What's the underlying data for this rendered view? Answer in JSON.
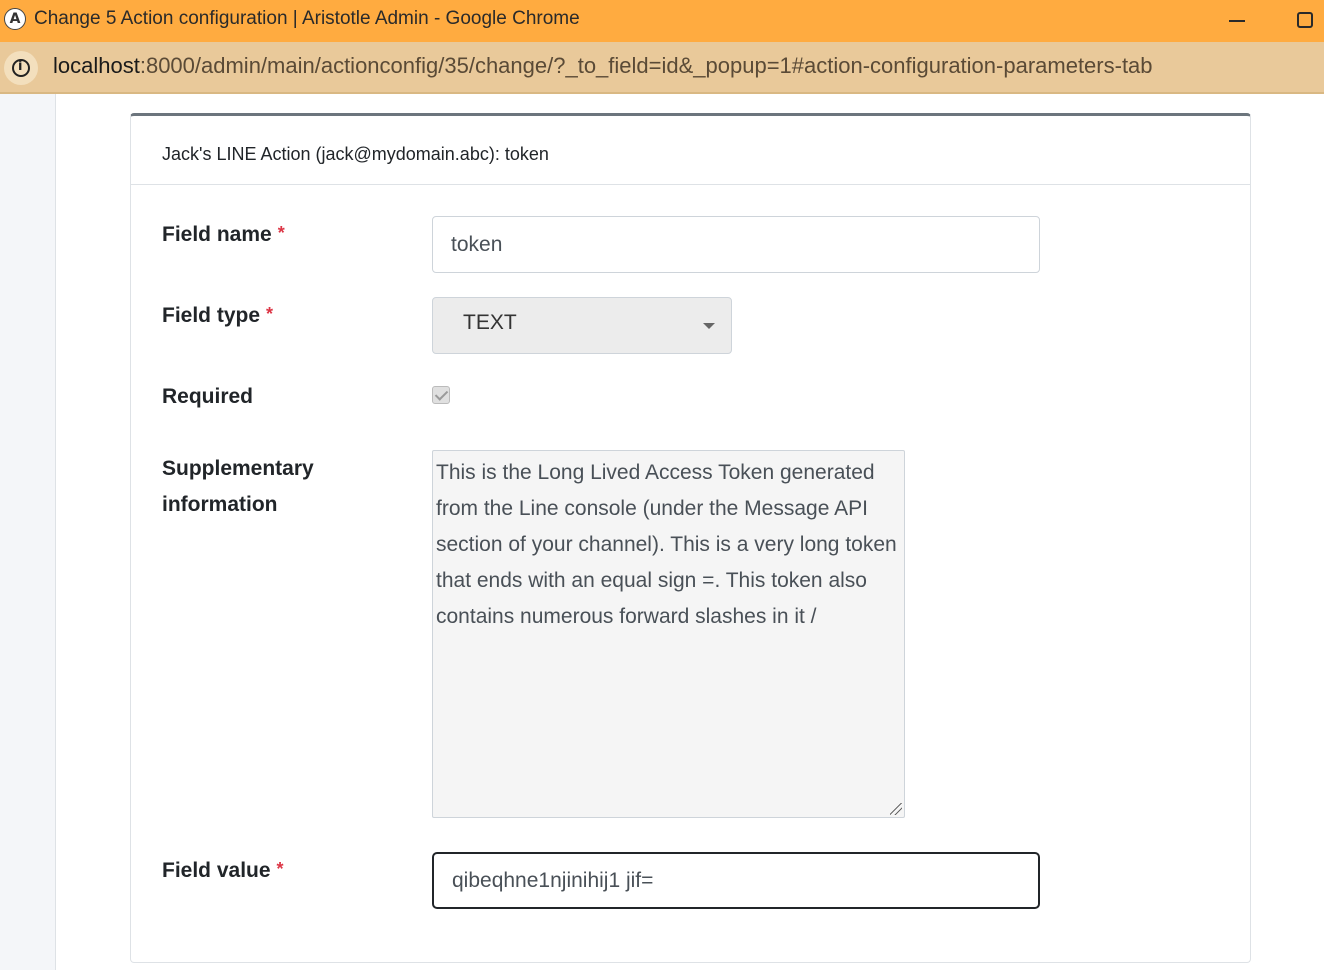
{
  "window": {
    "title": "Change 5 Action configuration | Aristotle Admin - Google Chrome",
    "app_icon_letter": "A"
  },
  "address_bar": {
    "host": "localhost",
    "path": ":8000/admin/main/actionconfig/35/change/?_to_field=id&_popup=1#action-configuration-parameters-tab"
  },
  "card": {
    "title": "Jack's LINE Action (jack@mydomain.abc): token"
  },
  "form": {
    "field_name": {
      "label": "Field name",
      "required_mark": "*",
      "value": "token"
    },
    "field_type": {
      "label": "Field type",
      "required_mark": "*",
      "value": "TEXT"
    },
    "required": {
      "label": "Required",
      "checked": true
    },
    "supplementary": {
      "label_line1": "Supplementary",
      "label_line2": "information",
      "value": "This is the Long Lived Access Token generated from the Line console (under the Message API section of your channel). This is a very long token that ends with an equal sign =. This token also contains numerous forward slashes in it /"
    },
    "field_value": {
      "label": "Field value",
      "required_mark": "*",
      "value": "qibeqhne1njinihij1 jif="
    }
  },
  "icons": [
    "app-logo-icon",
    "window-minimize-icon",
    "window-maximize-icon",
    "info-icon",
    "caret-down-icon",
    "check-icon",
    "resize-handle-icon"
  ]
}
